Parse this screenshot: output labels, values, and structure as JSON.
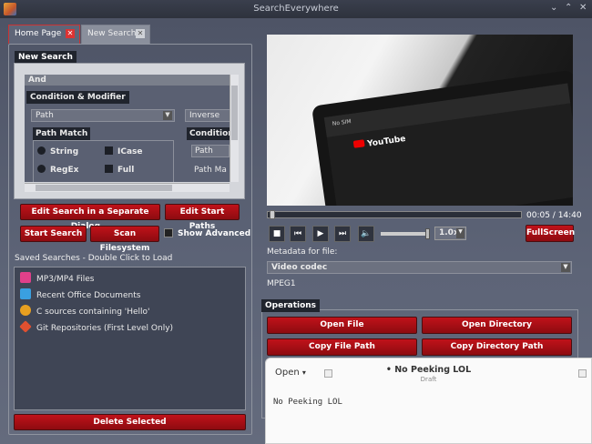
{
  "window": {
    "title": "SearchEverywhere",
    "controls": [
      "⌄",
      "⌃",
      "✕"
    ]
  },
  "tabs": [
    {
      "label": "Home Page",
      "close": "✕"
    },
    {
      "label": "New Search",
      "close": "✕"
    }
  ],
  "new_search": {
    "label": "New Search",
    "and": "And",
    "condition_modifier": "Condition & Modifier",
    "field_select": "Path",
    "inverse": "Inverse",
    "path_match": "Path Match",
    "condition": "Condition",
    "cond_field": "Path",
    "cond_pm": "Path Ma",
    "options": {
      "string": "String",
      "icase": "ICase",
      "regex": "RegEx",
      "full": "Full"
    }
  },
  "buttons": {
    "edit_dialog": "Edit Search in a Separate Dialog...",
    "edit_paths": "Edit Start Paths",
    "start": "Start Search",
    "scan": "Scan Filesystem",
    "show_advanced": "Show Advanced",
    "delete": "Delete Selected",
    "fullscreen": "FullScreen"
  },
  "saved": {
    "label": "Saved Searches - Double Click to Load",
    "items": [
      {
        "label": "MP3/MP4 Files",
        "icon": "music-file-icon",
        "color": "#e0408a"
      },
      {
        "label": "Recent Office Documents",
        "icon": "document-icon",
        "color": "#3aa0e0"
      },
      {
        "label": "C sources containing 'Hello'",
        "icon": "c-source-icon",
        "color": "#e8a020"
      },
      {
        "label": "Git Repositories (First Level Only)",
        "icon": "git-icon",
        "color": "#e05030"
      }
    ]
  },
  "player": {
    "time": "00:05 / 14:40",
    "rate": "1.0x",
    "video_text": "YouTube",
    "status_text": "No SIM"
  },
  "metadata": {
    "label": "Metadata for file:",
    "field": "Video codec",
    "value": "MPEG1"
  },
  "operations": {
    "label": "Operations",
    "buttons": [
      "Open File",
      "Open Directory",
      "Copy File Path",
      "Copy Directory Path"
    ]
  },
  "popover": {
    "open": "Open",
    "title": "• No Peeking LOL",
    "subtitle": "Draft",
    "body": "No Peeking LOL"
  },
  "colors": {
    "accent": "#c0121a",
    "panel": "#5a6174"
  }
}
